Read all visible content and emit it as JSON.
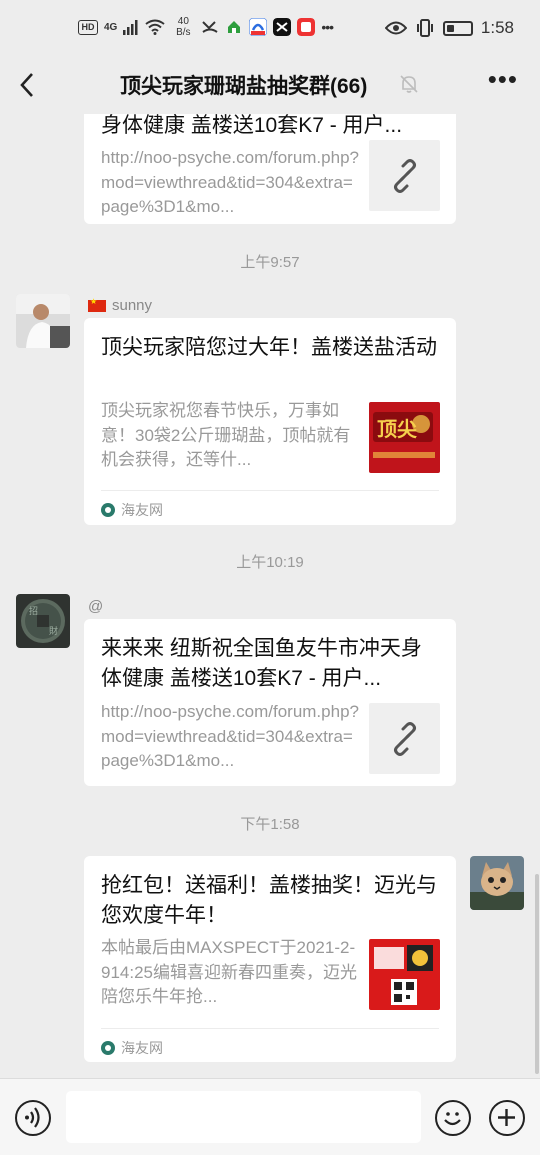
{
  "status_bar": {
    "hd": "HD",
    "network": "4G",
    "speed_value": "40",
    "speed_unit": "B/s",
    "time": "1:58",
    "battery_level": 0.3
  },
  "nav": {
    "title": "顶尖玩家珊瑚盐抽奖群(66)"
  },
  "messages": [
    {
      "title": "身体健康 盖楼送10套K7 - 用户...",
      "desc": "http://noo-psyche.com/forum.php?mod=viewthread&tid=304&extra=page%3D1&mo..."
    },
    {
      "time": "上午9:57",
      "sender": "sunny",
      "title": "顶尖玩家陪您过大年！盖楼送盐活动",
      "desc": "顶尖玩家祝您春节快乐，万事如意！30袋2公斤珊瑚盐，顶帖就有机会获得，还等什...",
      "source": "海友网"
    },
    {
      "time": "上午10:19",
      "sender": "@",
      "title": "来来来 纽斯祝全国鱼友牛市冲天身体健康 盖楼送10套K7 - 用户...",
      "desc": "http://noo-psyche.com/forum.php?mod=viewthread&tid=304&extra=page%3D1&mo..."
    },
    {
      "time": "下午1:58",
      "title": "抢红包！送福利！盖楼抽奖！迈光与您欢度牛年！",
      "desc": "本帖最后由MAXSPECT于2021-2-914:25编辑喜迎新春四重奏，迈光陪您乐牛年抢...",
      "source": "海友网"
    }
  ],
  "input": {
    "value": ""
  },
  "icons": {
    "back": "back-arrow-icon",
    "mute": "mute-bell-icon",
    "more": "more-dots-icon",
    "link": "link-icon",
    "voice": "voice-icon",
    "emoji": "emoji-icon",
    "plus": "plus-icon"
  },
  "colors": {
    "background": "#ededed",
    "card": "#ffffff",
    "secondary_text": "#999999"
  }
}
